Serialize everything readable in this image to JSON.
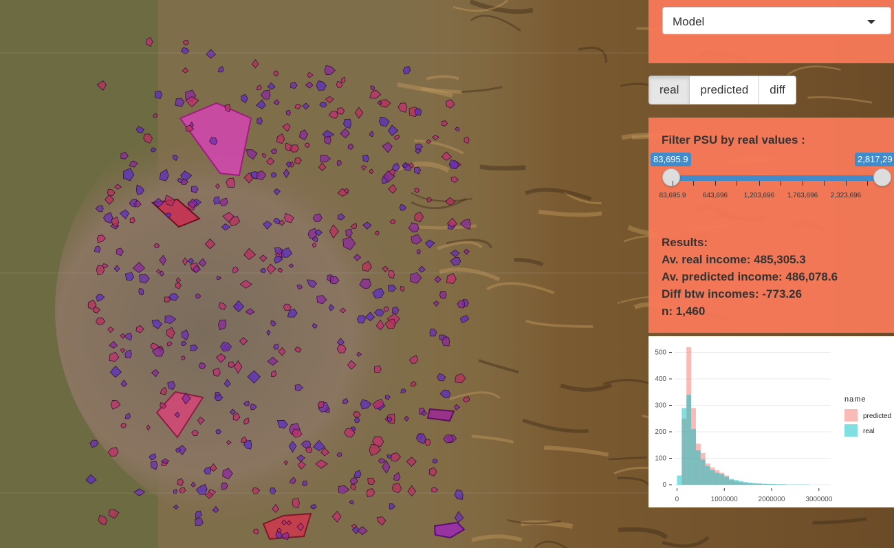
{
  "select": {
    "value": "Model"
  },
  "view_buttons": [
    {
      "label": "real",
      "active": true
    },
    {
      "label": "predicted",
      "active": false
    },
    {
      "label": "diff",
      "active": false
    }
  ],
  "filter": {
    "title": "Filter PSU by real values :",
    "slider_min_label": "83,695.9",
    "slider_max_label": "2,817,29",
    "min_value": 83695.9,
    "max_value": 2817296,
    "tick_labels": [
      "83,695.9",
      "643,696",
      "1,203,696",
      "1,763,696",
      "2,323,696"
    ]
  },
  "results": {
    "heading": "Results:",
    "av_real": "Av. real income: 485,305.3",
    "av_predicted": "Av. predicted income: 486,078.6",
    "diff": "Diff btw incomes: -773.26",
    "n": "n: 1,460"
  },
  "colors": {
    "panel": "#f87958",
    "slider": "#428bca",
    "real": "#00bfc4",
    "predicted": "#f8766d"
  },
  "chart_data": {
    "type": "bar",
    "legend_title": "name",
    "legend_position": "right",
    "series": [
      {
        "name": "predicted",
        "color": "#f8766d"
      },
      {
        "name": "real",
        "color": "#00bfc4"
      }
    ],
    "x_ticks": [
      0,
      1000000,
      2000000,
      3000000
    ],
    "x_tick_labels": [
      "0",
      "1000000",
      "2000000",
      "3000000"
    ],
    "y_ticks": [
      0,
      100,
      200,
      300,
      400,
      500
    ],
    "ylim": [
      0,
      530
    ],
    "xlim": [
      -50000,
      3250000
    ],
    "bin_width": 100000,
    "bins": [
      {
        "x": 50000,
        "real": 35,
        "predicted": 0
      },
      {
        "x": 150000,
        "real": 290,
        "predicted": 250
      },
      {
        "x": 250000,
        "real": 340,
        "predicted": 520
      },
      {
        "x": 350000,
        "real": 210,
        "predicted": 290
      },
      {
        "x": 450000,
        "real": 130,
        "predicted": 155
      },
      {
        "x": 550000,
        "real": 95,
        "predicted": 120
      },
      {
        "x": 650000,
        "real": 70,
        "predicted": 80
      },
      {
        "x": 750000,
        "real": 55,
        "predicted": 65
      },
      {
        "x": 850000,
        "real": 45,
        "predicted": 55
      },
      {
        "x": 950000,
        "real": 40,
        "predicted": 45
      },
      {
        "x": 1050000,
        "real": 30,
        "predicted": 35
      },
      {
        "x": 1150000,
        "real": 22,
        "predicted": 18
      },
      {
        "x": 1250000,
        "real": 18,
        "predicted": 12
      },
      {
        "x": 1350000,
        "real": 14,
        "predicted": 9
      },
      {
        "x": 1450000,
        "real": 10,
        "predicted": 7
      },
      {
        "x": 1550000,
        "real": 8,
        "predicted": 5
      },
      {
        "x": 1650000,
        "real": 6,
        "predicted": 4
      },
      {
        "x": 1750000,
        "real": 5,
        "predicted": 3
      },
      {
        "x": 1850000,
        "real": 4,
        "predicted": 2
      },
      {
        "x": 1950000,
        "real": 3,
        "predicted": 2
      },
      {
        "x": 2050000,
        "real": 3,
        "predicted": 1
      },
      {
        "x": 2150000,
        "real": 2,
        "predicted": 1
      },
      {
        "x": 2250000,
        "real": 2,
        "predicted": 1
      },
      {
        "x": 2350000,
        "real": 1,
        "predicted": 0
      },
      {
        "x": 2450000,
        "real": 1,
        "predicted": 0
      },
      {
        "x": 2550000,
        "real": 1,
        "predicted": 0
      },
      {
        "x": 2650000,
        "real": 1,
        "predicted": 0
      },
      {
        "x": 2750000,
        "real": 1,
        "predicted": 0
      }
    ]
  }
}
